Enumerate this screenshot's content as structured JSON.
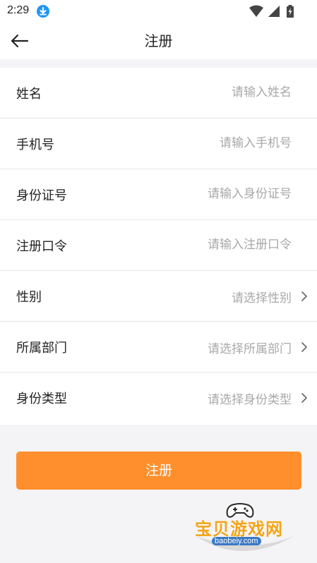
{
  "status": {
    "time": "2:29"
  },
  "appbar": {
    "title": "注册"
  },
  "form": {
    "fields": [
      {
        "label": "姓名",
        "placeholder": "请输入姓名"
      },
      {
        "label": "手机号",
        "placeholder": "请输入手机号"
      },
      {
        "label": "身份证号",
        "placeholder": "请输入身份证号"
      },
      {
        "label": "注册口令",
        "placeholder": "请输入注册口令"
      }
    ],
    "selects": [
      {
        "label": "性别",
        "value": "请选择性别"
      },
      {
        "label": "所属部门",
        "value": "请选择所属部门"
      },
      {
        "label": "身份类型",
        "value": "请选择身份类型"
      }
    ]
  },
  "submit_label": "注册",
  "watermark": {
    "text": "宝贝游戏网",
    "sub": "baobeiy.com"
  },
  "colors": {
    "accent": "#ff8f2c",
    "download_badge": "#2196f3"
  }
}
